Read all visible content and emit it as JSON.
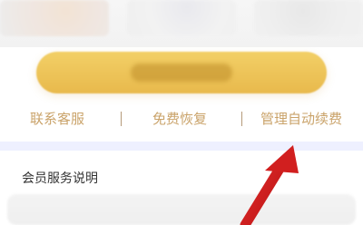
{
  "links": {
    "contact_support": "联系客服",
    "restore_free": "免费恢复",
    "manage_auto_renew": "管理自动续费"
  },
  "section": {
    "member_service_title": "会员服务说明"
  },
  "icons": {
    "annotation_arrow": "red-arrow-icon"
  },
  "colors": {
    "link_gold": "#caa36a",
    "cta_gold": "#e8b94c",
    "annotation_red": "#d11f1f"
  }
}
